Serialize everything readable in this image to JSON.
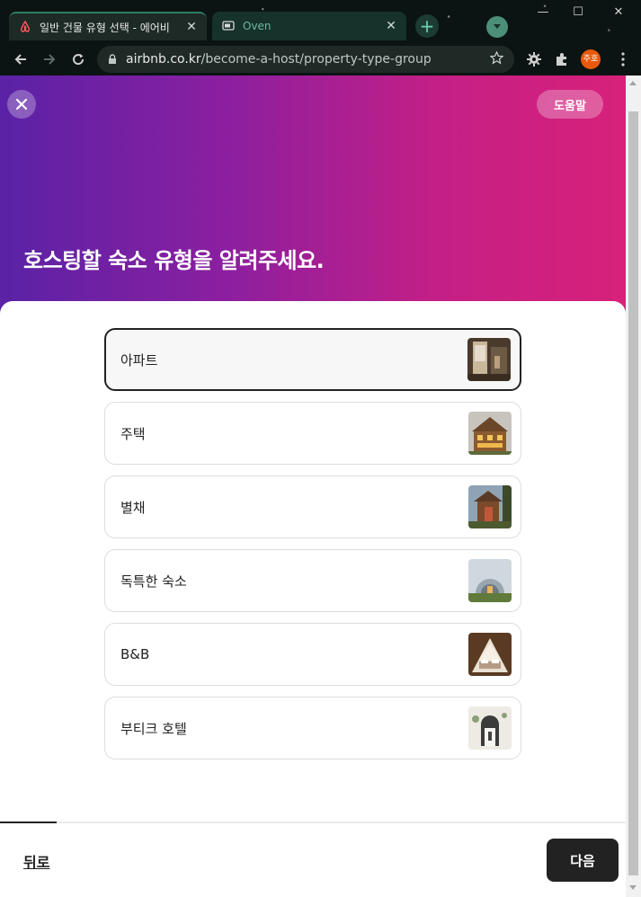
{
  "browser": {
    "tabs": [
      {
        "title": "일반 건물 유형 선택 - 에어비",
        "icon": "airbnb-icon",
        "active": true
      },
      {
        "title": "Oven",
        "icon": "oven-icon",
        "active": false
      }
    ],
    "url_host": "airbnb.co.kr",
    "url_path": "/become-a-host/property-type-group",
    "profile_label": "주호"
  },
  "header": {
    "help_label": "도움말",
    "title": "호스팅할 숙소 유형을 알려주세요."
  },
  "options": [
    {
      "label": "아파트",
      "selected": true,
      "thumb": "apartment-photo"
    },
    {
      "label": "주택",
      "selected": false,
      "thumb": "house-photo"
    },
    {
      "label": "별채",
      "selected": false,
      "thumb": "annex-photo"
    },
    {
      "label": "독특한 숙소",
      "selected": false,
      "thumb": "unique-stay-photo"
    },
    {
      "label": "B&B",
      "selected": false,
      "thumb": "bnb-photo"
    },
    {
      "label": "부티크 호텔",
      "selected": false,
      "thumb": "boutique-hotel-photo"
    }
  ],
  "footer": {
    "back_label": "뒤로",
    "next_label": "다음",
    "progress_fraction": 0.09
  },
  "colors": {
    "gradient_start": "#5a22a6",
    "gradient_end": "#d8217a",
    "primary_dark": "#222222"
  }
}
